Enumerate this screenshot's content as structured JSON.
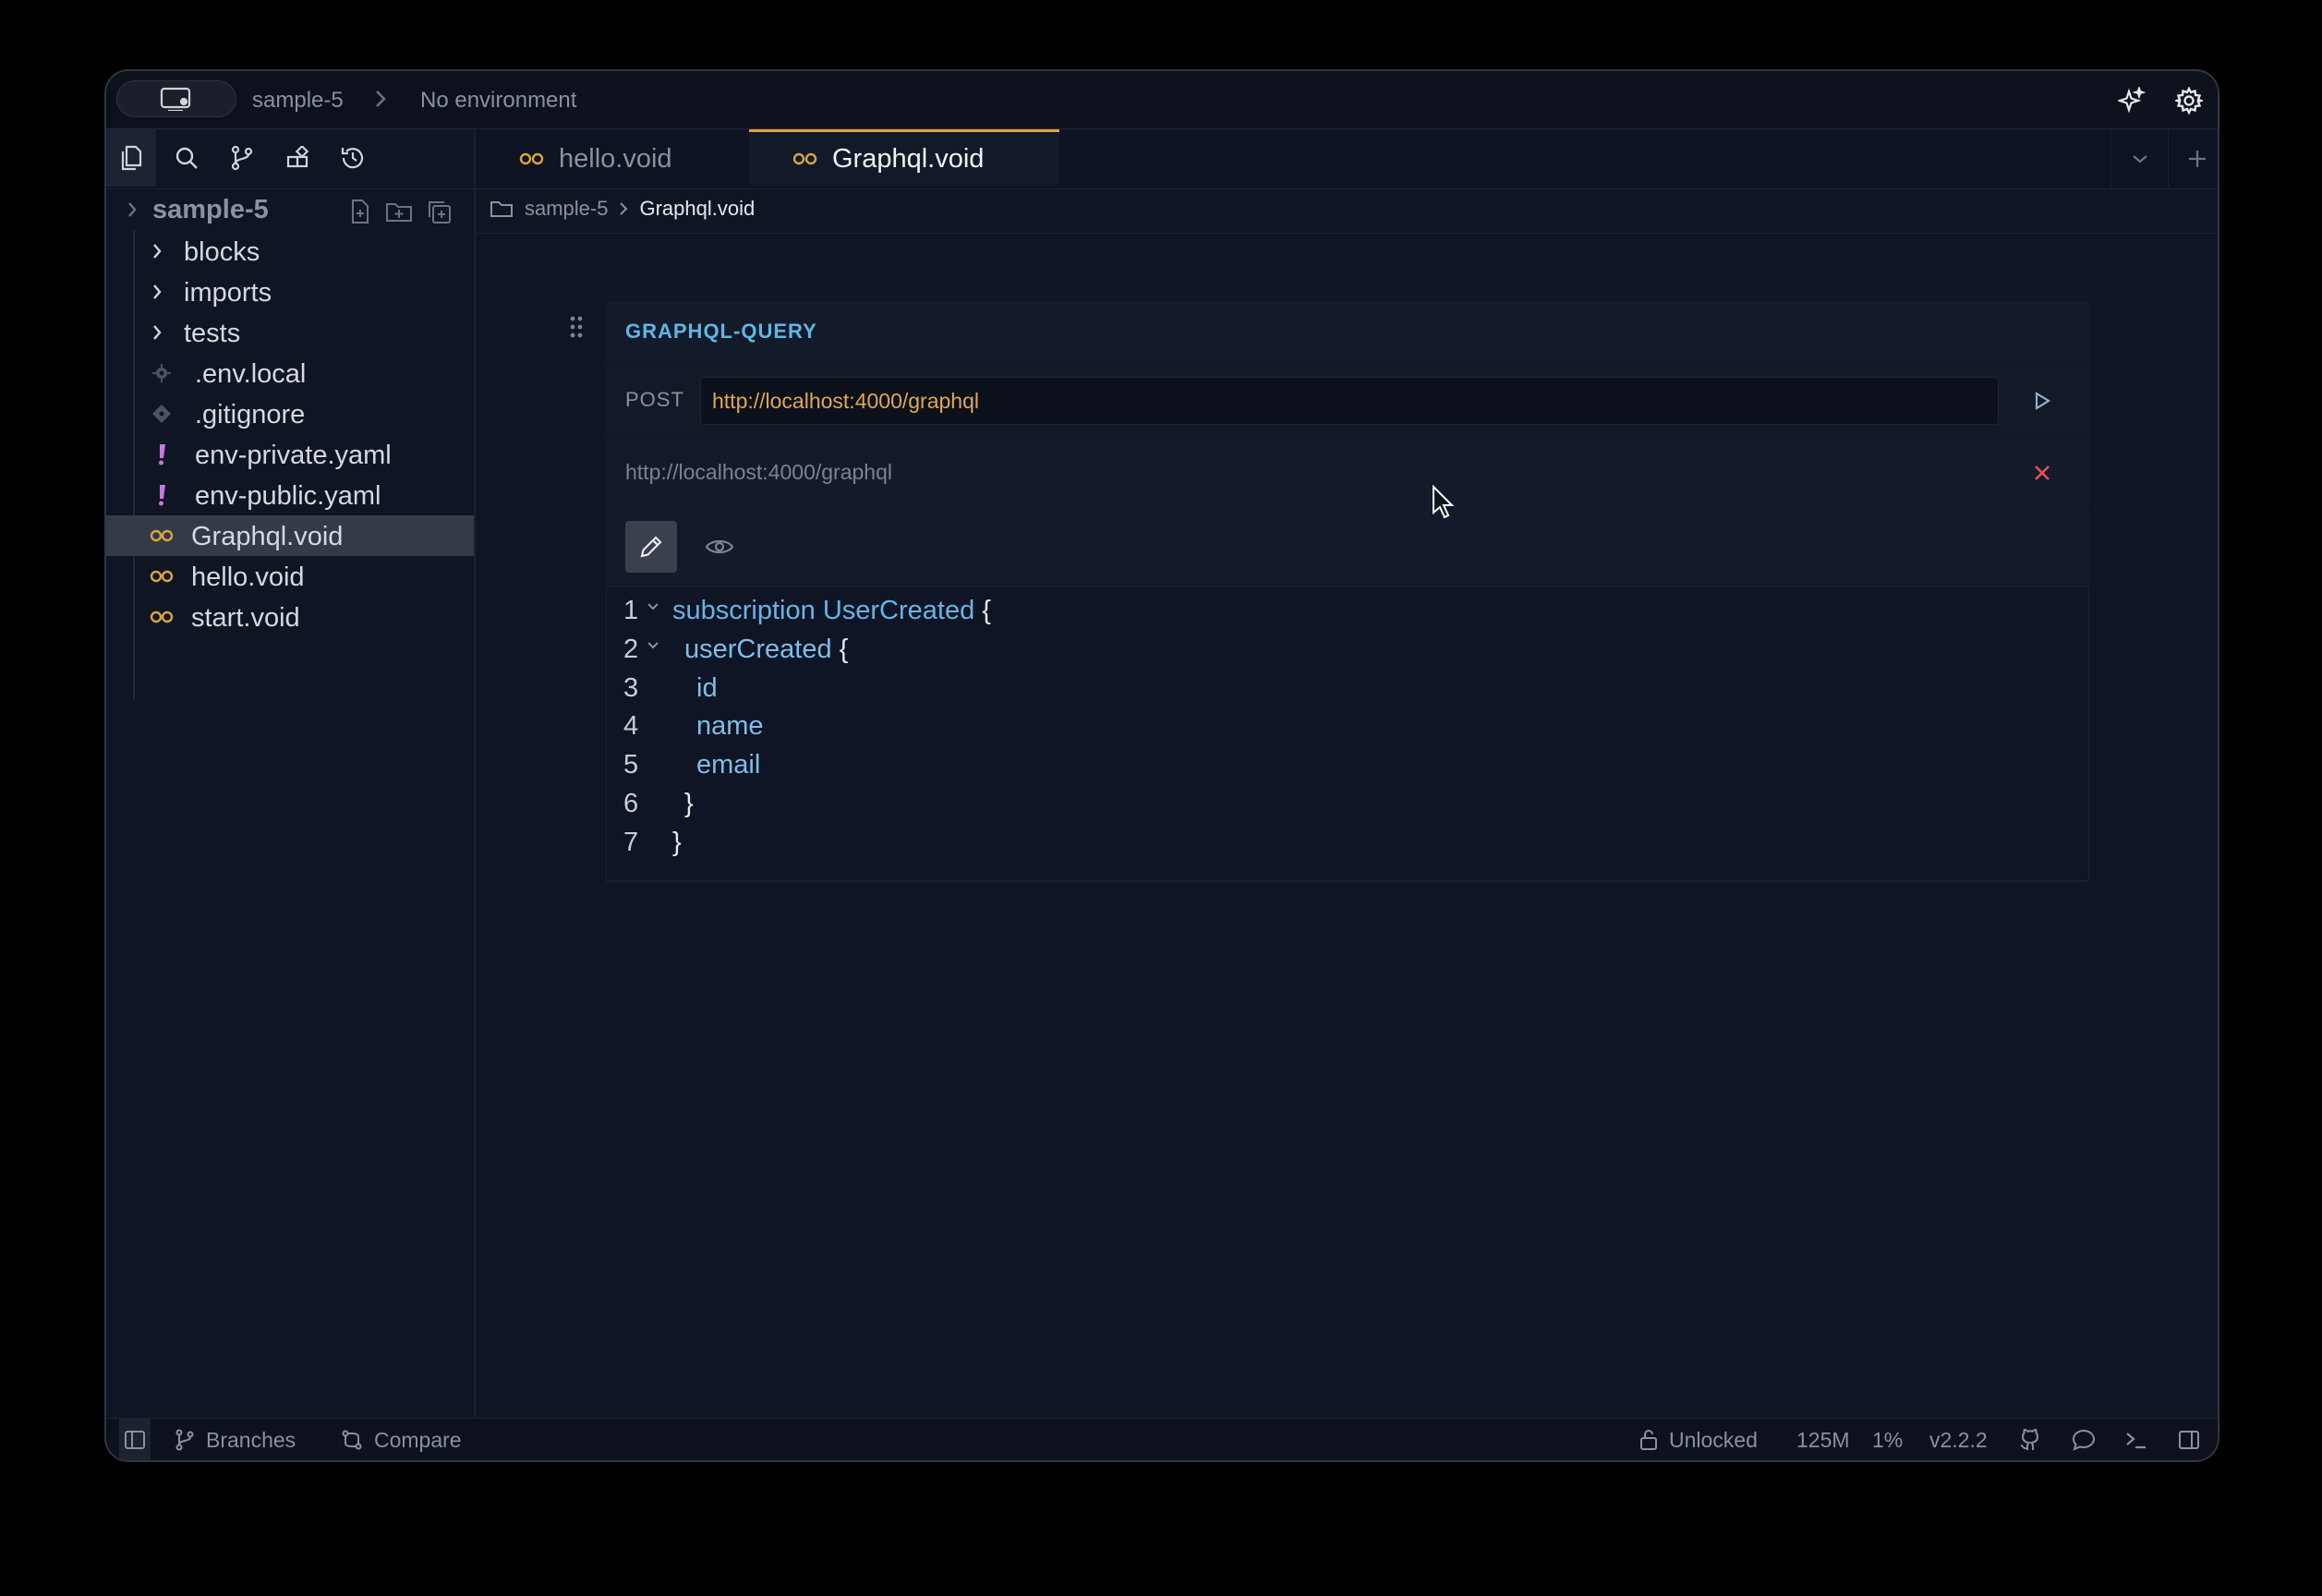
{
  "titlebar": {
    "project": "sample-5",
    "environment": "No environment"
  },
  "sidebar": {
    "root": "sample-5",
    "items": [
      {
        "label": "blocks",
        "type": "folder"
      },
      {
        "label": "imports",
        "type": "folder"
      },
      {
        "label": "tests",
        "type": "folder"
      },
      {
        "label": ".env.local",
        "type": "env"
      },
      {
        "label": ".gitignore",
        "type": "git"
      },
      {
        "label": "env-private.yaml",
        "type": "yaml"
      },
      {
        "label": "env-public.yaml",
        "type": "yaml"
      },
      {
        "label": "Graphql.void",
        "type": "void",
        "selected": true
      },
      {
        "label": "hello.void",
        "type": "void"
      },
      {
        "label": "start.void",
        "type": "void"
      }
    ]
  },
  "tabs": [
    {
      "label": "hello.void",
      "active": false
    },
    {
      "label": "Graphql.void",
      "active": true
    }
  ],
  "breadcrumb": {
    "folder": "sample-5",
    "file": "Graphql.void"
  },
  "block": {
    "title": "GRAPHQL-QUERY",
    "method": "POST",
    "url": "http://localhost:4000/graphql",
    "ws_url": "http://localhost:4000/graphql",
    "code": [
      {
        "n": "1",
        "fold": true,
        "indent": 0,
        "parts": [
          [
            "kw",
            "subscription "
          ],
          [
            "fn",
            "UserCreated"
          ],
          [
            "br",
            " {"
          ]
        ]
      },
      {
        "n": "2",
        "fold": true,
        "indent": 1,
        "parts": [
          [
            "fld",
            "userCreated"
          ],
          [
            "br",
            " {"
          ]
        ]
      },
      {
        "n": "3",
        "fold": false,
        "indent": 2,
        "parts": [
          [
            "fld",
            "id"
          ]
        ]
      },
      {
        "n": "4",
        "fold": false,
        "indent": 2,
        "parts": [
          [
            "fld",
            "name"
          ]
        ]
      },
      {
        "n": "5",
        "fold": false,
        "indent": 2,
        "parts": [
          [
            "fld",
            "email"
          ]
        ]
      },
      {
        "n": "6",
        "fold": false,
        "indent": 1,
        "parts": [
          [
            "br",
            "}"
          ]
        ]
      },
      {
        "n": "7",
        "fold": false,
        "indent": 0,
        "parts": [
          [
            "br",
            "}"
          ]
        ]
      }
    ]
  },
  "statusbar": {
    "branches": "Branches",
    "compare": "Compare",
    "lock": "Unlocked",
    "memory": "125M",
    "cpu": "1%",
    "version": "v2.2.2"
  },
  "colors": {
    "accent_tab": "#d9a441",
    "void_icon": "#d9a441",
    "yaml_icon": "#c678dd",
    "block_title": "#62b5e5",
    "url_text": "#e2a655",
    "close_red": "#e05252"
  }
}
